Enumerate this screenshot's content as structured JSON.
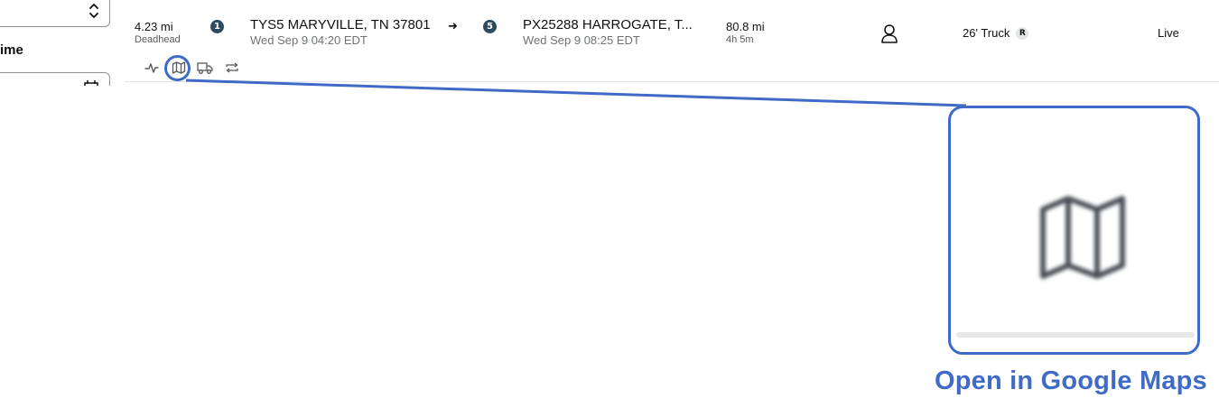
{
  "left_panel": {
    "section_label": "ime"
  },
  "load": {
    "deadhead": {
      "distance": "4.23 mi",
      "label": "Deadhead"
    },
    "origin": {
      "stop_number": "1",
      "name": "TYS5 MARYVILLE, TN 37801",
      "time": "Wed Sep 9 04:20 EDT"
    },
    "arrow": "➜",
    "destination": {
      "stop_number": "5",
      "name": "PX25288 HARROGATE, T...",
      "time": "Wed Sep 9 08:25 EDT"
    },
    "trip": {
      "distance": "80.8 mi",
      "duration": "4h 5m"
    },
    "equipment": {
      "label": "26' Truck",
      "badge": "R"
    },
    "status": "Live"
  },
  "toolbar": {
    "icons": [
      "activity-icon",
      "map-icon",
      "truck-icon",
      "swap-icon"
    ]
  },
  "callout": {
    "caption": "Open in Google Maps",
    "accent_color": "#3f6bc6"
  }
}
